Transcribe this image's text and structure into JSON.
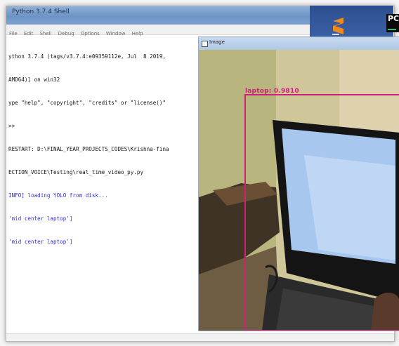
{
  "shell": {
    "title": "Python 3.7.4 Shell",
    "menu": [
      "File",
      "Edit",
      "Shell",
      "Debug",
      "Options",
      "Window",
      "Help"
    ],
    "lines": [
      {
        "text": "ython 3.7.4 (tags/v3.7.4:e09359112e, Jul  8 2019,",
        "style": "normal"
      },
      {
        "text": "AMD64)] on win32",
        "style": "normal"
      },
      {
        "text": "ype \"help\", \"copyright\", \"credits\" or \"license()\"",
        "style": "normal"
      },
      {
        "text": ">>",
        "style": "normal"
      },
      {
        "text": "RESTART: D:\\FINAL_YEAR_PROJECTS_CODES\\Krishna-fina",
        "style": "normal"
      },
      {
        "text": "ECTION_VOICE\\Testing\\real_time_video_py.py",
        "style": "normal"
      },
      {
        "text": "INFO] loading YOLO from disk...",
        "style": "blue"
      },
      {
        "text": "'mid center laptop']",
        "style": "blue"
      },
      {
        "text": "'mid center laptop']",
        "style": "blue"
      }
    ]
  },
  "desktop": {
    "icons": [
      {
        "name": "sublime-text-icon",
        "color": "#f08a1f"
      },
      {
        "name": "pycharm-icon",
        "label": "PC",
        "accent": "#1ec97b"
      }
    ]
  },
  "image_window": {
    "title": "Image",
    "detection": {
      "label": "laptop: 0.9810",
      "color": "#cf1f76"
    }
  }
}
